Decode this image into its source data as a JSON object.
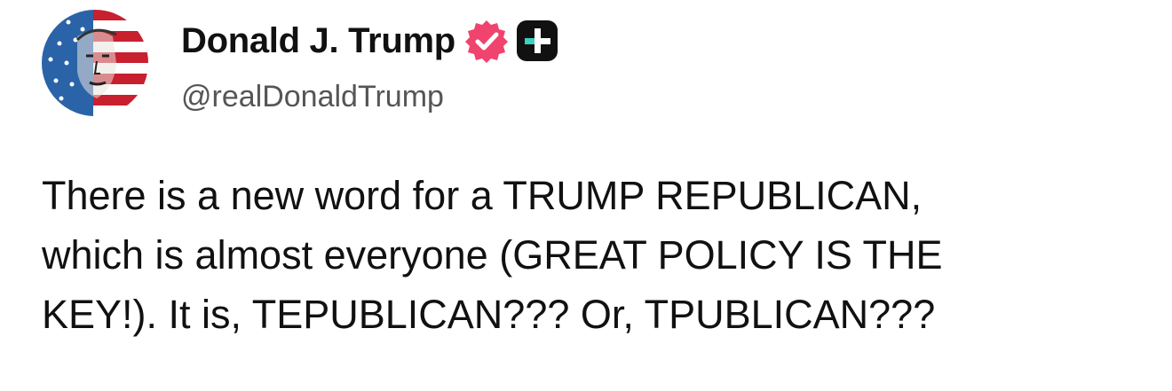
{
  "post": {
    "author": {
      "display_name": "Donald J. Trump",
      "handle": "@realDonaldTrump",
      "avatar_icon": "flag-portrait-avatar",
      "verified_icon": "verified-badge-icon",
      "plus_icon": "plus-badge-icon"
    },
    "body_lines": [
      "There is a new word for a TRUMP REPUBLICAN,",
      "which is almost everyone (GREAT POLICY IS THE",
      "KEY!). It is, TEPUBLICAN??? Or, TPUBLICAN???"
    ]
  },
  "colors": {
    "verified_pink": "#f0436e",
    "plus_badge_bg": "#111111",
    "plus_badge_accent": "#37d3c3",
    "handle_gray": "#555555",
    "flag_red": "#c8202f",
    "flag_blue": "#2a63a8"
  }
}
